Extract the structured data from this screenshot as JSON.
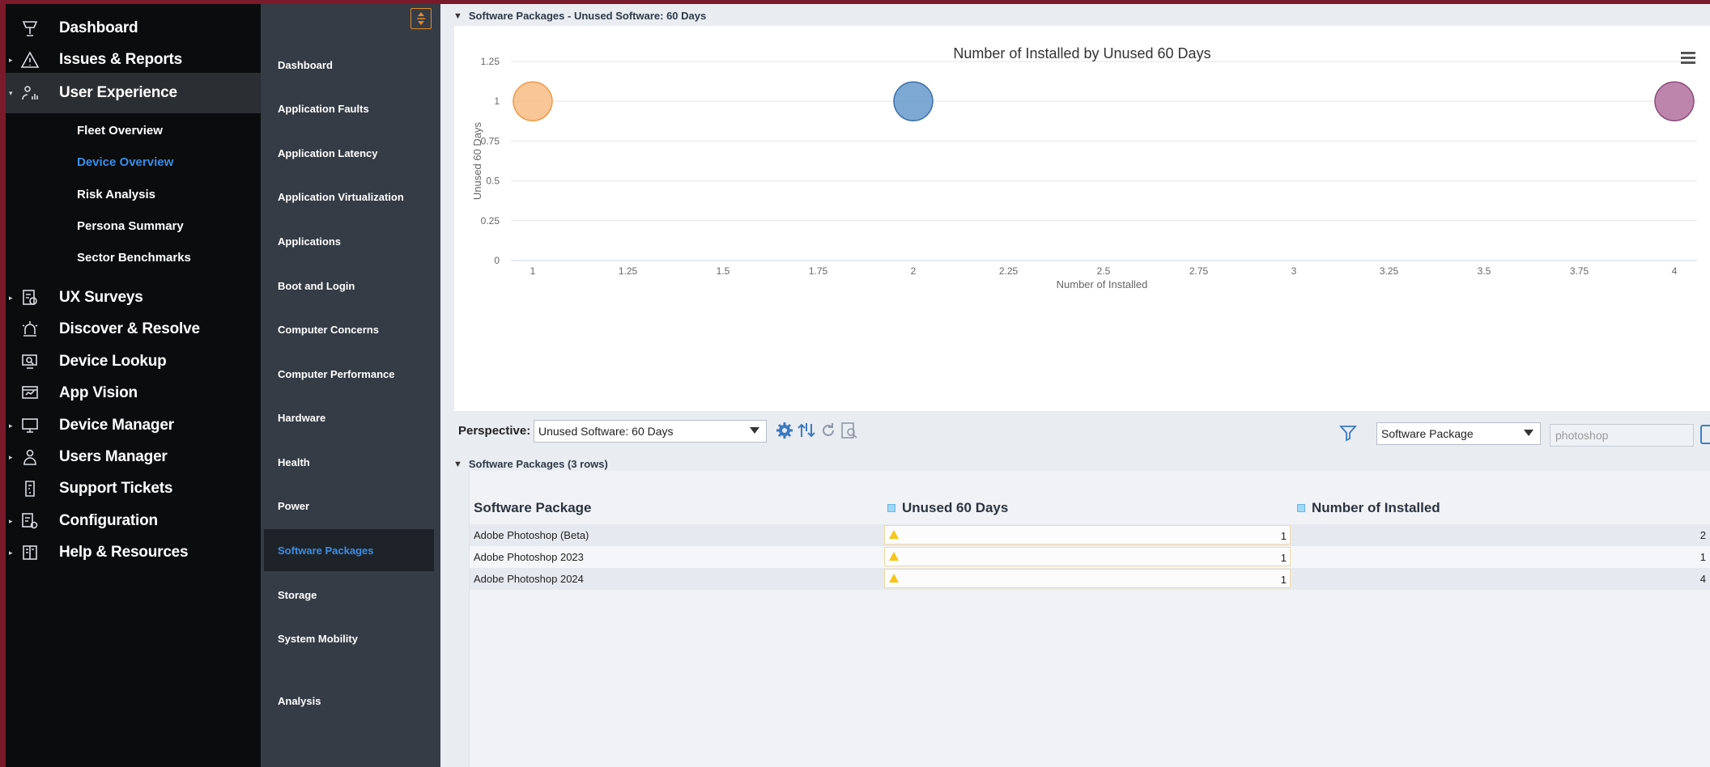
{
  "left_nav": {
    "items": [
      {
        "label": "Dashboard",
        "icon": "trophy-icon",
        "caret": false
      },
      {
        "label": "Issues & Reports",
        "icon": "warning-icon",
        "caret": true
      },
      {
        "label": "User Experience",
        "icon": "user-chart-icon",
        "caret": true,
        "expanded": true
      },
      {
        "label": "UX Surveys",
        "icon": "survey-icon",
        "caret": true
      },
      {
        "label": "Discover & Resolve",
        "icon": "alarm-icon",
        "caret": false
      },
      {
        "label": "Device Lookup",
        "icon": "device-search-icon",
        "caret": false
      },
      {
        "label": "App Vision",
        "icon": "app-vision-icon",
        "caret": false
      },
      {
        "label": "Device Manager",
        "icon": "monitor-icon",
        "caret": true
      },
      {
        "label": "Users Manager",
        "icon": "user-icon",
        "caret": true
      },
      {
        "label": "Support Tickets",
        "icon": "ticket-icon",
        "caret": false
      },
      {
        "label": "Configuration",
        "icon": "config-icon",
        "caret": true
      },
      {
        "label": "Help & Resources",
        "icon": "book-icon",
        "caret": true
      }
    ],
    "subitems": [
      "Fleet Overview",
      "Device Overview",
      "Risk Analysis",
      "Persona Summary",
      "Sector Benchmarks"
    ],
    "selected_subitem": "Device Overview"
  },
  "sub_nav": {
    "items": [
      "Dashboard",
      "Application Faults",
      "Application Latency",
      "Application Virtualization",
      "Applications",
      "Boot and Login",
      "Computer Concerns",
      "Computer Performance",
      "Hardware",
      "Health",
      "Power",
      "Software Packages",
      "Storage",
      "System Mobility"
    ],
    "analysis": "Analysis",
    "selected": "Software Packages"
  },
  "chart_section": {
    "header": "Software Packages - Unused Software: 60 Days"
  },
  "chart_data": {
    "type": "scatter",
    "title": "Number of Installed by Unused 60 Days",
    "xlabel": "Number of Installed",
    "ylabel": "Unused 60 Days",
    "xlim": [
      1,
      4
    ],
    "ylim": [
      0,
      1.25
    ],
    "x_ticks": [
      "1",
      "1.25",
      "1.5",
      "1.75",
      "2",
      "2.25",
      "2.5",
      "2.75",
      "3",
      "3.25",
      "3.5",
      "3.75",
      "4"
    ],
    "y_ticks": [
      "0",
      "0.25",
      "0.5",
      "0.75",
      "1",
      "1.25"
    ],
    "grid": true,
    "points": [
      {
        "x": 1,
        "y": 1,
        "color": "#f7c08c",
        "stroke": "#f09a4a"
      },
      {
        "x": 2,
        "y": 1,
        "color": "#6f9fcf",
        "stroke": "#3a6fa8"
      },
      {
        "x": 4,
        "y": 1,
        "color": "#b778a3",
        "stroke": "#8c4a7b"
      }
    ]
  },
  "toolbar": {
    "perspective_label": "Perspective:",
    "perspective_value": "Unused Software: 60 Days",
    "filter_field": "Software Package",
    "filter_placeholder": "photoshop"
  },
  "table_section": {
    "header": "Software Packages (3 rows)",
    "columns": [
      "Software Package",
      "Unused 60 Days",
      "Number of Installed"
    ],
    "rows": [
      {
        "name": "Adobe Photoshop (Beta)",
        "unused": "1",
        "installed": "2"
      },
      {
        "name": "Adobe Photoshop 2023",
        "unused": "1",
        "installed": "1"
      },
      {
        "name": "Adobe Photoshop 2024",
        "unused": "1",
        "installed": "4"
      }
    ]
  },
  "colors": {
    "accent": "#3a8ee8",
    "warning": "#f5c518",
    "nav_bg": "#0b0c0e",
    "subnav_bg": "#353c46"
  }
}
